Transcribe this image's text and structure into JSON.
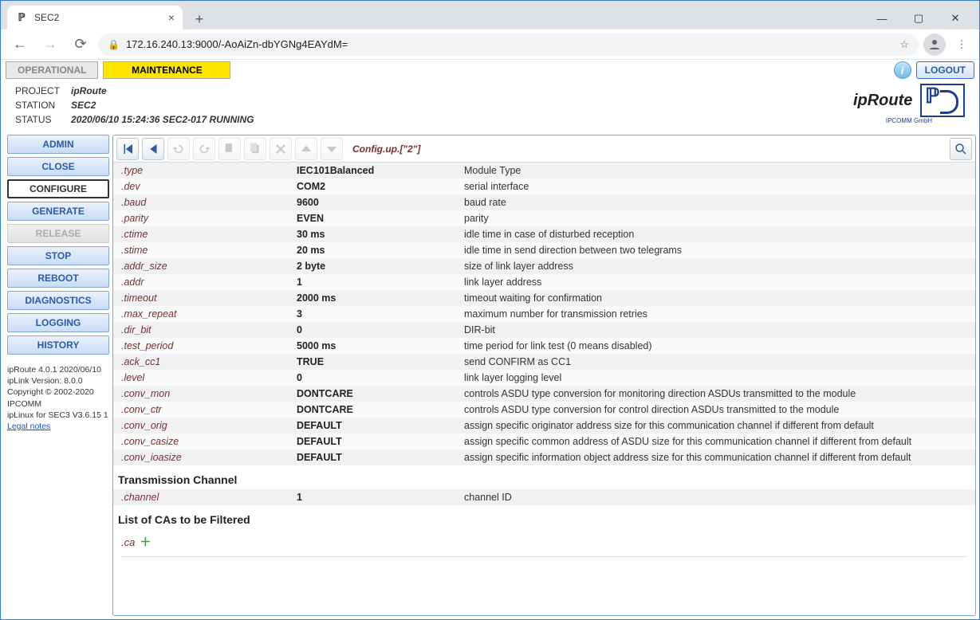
{
  "browser": {
    "tab_title": "SEC2",
    "url": "172.16.240.13:9000/-AoAiZn-dbYGNg4EAYdM="
  },
  "top": {
    "operational": "OPERATIONAL",
    "maintenance": "MAINTENANCE",
    "logout": "LOGOUT"
  },
  "project": {
    "labels": {
      "project": "PROJECT",
      "station": "STATION",
      "status": "STATUS"
    },
    "name": "ipRoute",
    "station": "SEC2",
    "status": "2020/06/10 15:24:36 SEC2-017 RUNNING"
  },
  "brand": {
    "title": "ipRoute",
    "sub": "IPCOMM GmbH"
  },
  "sidebar": {
    "items": [
      {
        "label": "ADMIN",
        "state": "normal"
      },
      {
        "label": "CLOSE",
        "state": "normal"
      },
      {
        "label": "CONFIGURE",
        "state": "selected"
      },
      {
        "label": "GENERATE",
        "state": "normal"
      },
      {
        "label": "RELEASE",
        "state": "disabled"
      },
      {
        "label": "STOP",
        "state": "normal"
      },
      {
        "label": "REBOOT",
        "state": "normal"
      },
      {
        "label": "DIAGNOSTICS",
        "state": "normal"
      },
      {
        "label": "LOGGING",
        "state": "normal"
      },
      {
        "label": "HISTORY",
        "state": "normal"
      }
    ],
    "footer": {
      "l1": "ipRoute 4.0.1 2020/06/10",
      "l2": "ipLink Version: 8.0.0",
      "l3": "Copyright © 2002-2020 IPCOMM",
      "l4": "ipLinux for SEC3 V3.6.15 1",
      "link": "Legal notes"
    }
  },
  "toolbar": {
    "breadcrumb": "Config.up.[\"2\"]"
  },
  "config_rows": [
    {
      "key": ".type",
      "val": "IEC101Balanced",
      "desc": "Module Type"
    },
    {
      "key": ".dev",
      "val": "COM2",
      "desc": "serial interface"
    },
    {
      "key": ".baud",
      "val": "9600",
      "desc": "baud rate"
    },
    {
      "key": ".parity",
      "val": "EVEN",
      "desc": "parity"
    },
    {
      "key": ".ctime",
      "val": "30 ms",
      "desc": "idle time in case of disturbed reception"
    },
    {
      "key": ".stime",
      "val": "20 ms",
      "desc": "idle time in send direction between two telegrams"
    },
    {
      "key": ".addr_size",
      "val": "2 byte",
      "desc": "size of link layer address"
    },
    {
      "key": ".addr",
      "val": "1",
      "desc": "link layer address"
    },
    {
      "key": ".timeout",
      "val": "2000 ms",
      "desc": "timeout waiting for confirmation"
    },
    {
      "key": ".max_repeat",
      "val": "3",
      "desc": "maximum number for transmission retries"
    },
    {
      "key": ".dir_bit",
      "val": "0",
      "desc": "DIR-bit"
    },
    {
      "key": ".test_period",
      "val": "5000 ms",
      "desc": "time period for link test (0 means disabled)"
    },
    {
      "key": ".ack_cc1",
      "val": "TRUE",
      "desc": "send CONFIRM as CC1"
    },
    {
      "key": ".level",
      "val": "0",
      "desc": "link layer logging level"
    },
    {
      "key": ".conv_mon",
      "val": "DONTCARE",
      "desc": "controls ASDU type conversion for monitoring direction ASDUs transmitted to the module"
    },
    {
      "key": ".conv_ctr",
      "val": "DONTCARE",
      "desc": "controls ASDU type conversion for control direction ASDUs transmitted to the module"
    },
    {
      "key": ".conv_orig",
      "val": "DEFAULT",
      "desc": "assign specific originator address size for this communication channel if different from default"
    },
    {
      "key": ".conv_casize",
      "val": "DEFAULT",
      "desc": "assign specific common address of ASDU size for this communication channel if different from default"
    },
    {
      "key": ".conv_ioasize",
      "val": "DEFAULT",
      "desc": "assign specific information object address size for this communication channel if different from default"
    }
  ],
  "sections": {
    "tx_header": "Transmission Channel",
    "tx_row": {
      "key": ".channel",
      "val": "1",
      "desc": "channel ID"
    },
    "ca_header": "List of CAs to be Filtered",
    "ca_key": ".ca"
  }
}
